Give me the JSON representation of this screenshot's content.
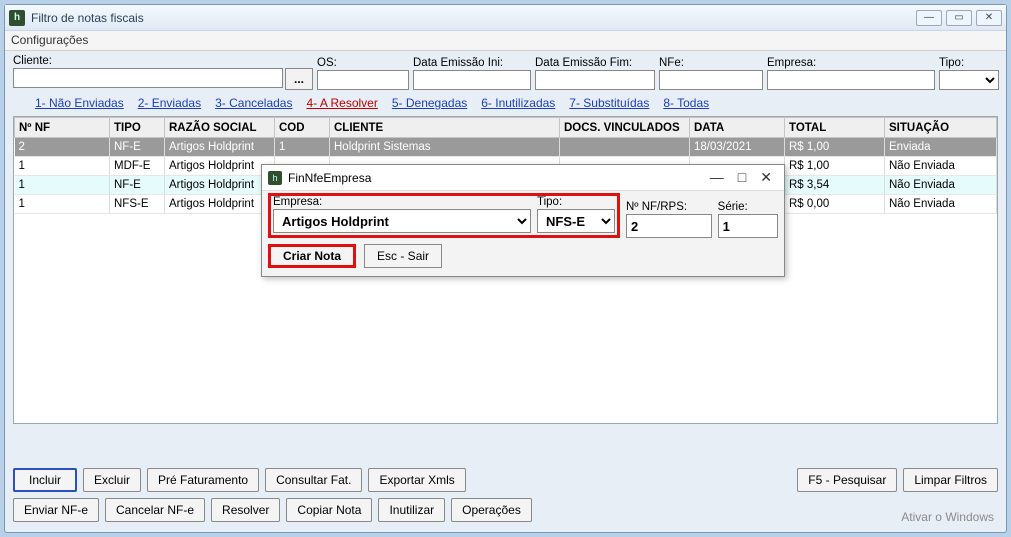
{
  "window": {
    "title": "Filtro de notas fiscais"
  },
  "menu": {
    "config": "Configurações"
  },
  "filters": {
    "cliente": {
      "label": "Cliente:",
      "value": ""
    },
    "os": {
      "label": "OS:",
      "value": ""
    },
    "data_ini": {
      "label": "Data Emissão Ini:",
      "value": ""
    },
    "data_fim": {
      "label": "Data Emissão Fim:",
      "value": ""
    },
    "nfe": {
      "label": "NFe:",
      "value": ""
    },
    "empresa": {
      "label": "Empresa:",
      "value": ""
    },
    "tipo": {
      "label": "Tipo:",
      "value": ""
    }
  },
  "tabs": {
    "t1": "1- Não Enviadas",
    "t2": "2- Enviadas",
    "t3": "3- Canceladas",
    "t4": "4- A Resolver",
    "t5": "5- Denegadas",
    "t6": "6- Inutilizadas",
    "t7": "7- Substituídas",
    "t8": "8- Todas"
  },
  "cols": {
    "nf": "Nº NF",
    "tipo": "TIPO",
    "razao": "RAZÃO SOCIAL",
    "cod": "COD",
    "cliente": "CLIENTE",
    "docs": "DOCS. VINCULADOS",
    "data": "DATA",
    "total": "TOTAL",
    "sit": "SITUAÇÃO"
  },
  "rows": [
    {
      "nf": "2",
      "tipo": "NF-E",
      "razao": "Artigos Holdprint",
      "cod": "1",
      "cliente": "Holdprint Sistemas",
      "docs": "",
      "data": "18/03/2021",
      "total": "R$ 1,00",
      "sit": "Enviada"
    },
    {
      "nf": "1",
      "tipo": "MDF-E",
      "razao": "Artigos Holdprint",
      "cod": "",
      "cliente": "",
      "docs": "",
      "data": "",
      "total": "R$ 1,00",
      "sit": "Não Enviada"
    },
    {
      "nf": "1",
      "tipo": "NF-E",
      "razao": "Artigos Holdprint",
      "cod": "",
      "cliente": "",
      "docs": "",
      "data": "",
      "total": "R$ 3,54",
      "sit": "Não Enviada"
    },
    {
      "nf": "1",
      "tipo": "NFS-E",
      "razao": "Artigos Holdprint",
      "cod": "",
      "cliente": "",
      "docs": "",
      "data": "",
      "total": "R$ 0,00",
      "sit": "Não Enviada"
    }
  ],
  "buttons": {
    "incluir": "Incluir",
    "excluir": "Excluir",
    "prefat": "Pré Faturamento",
    "consfat": "Consultar Fat.",
    "expxml": "Exportar Xmls",
    "pesquisar": "F5 - Pesquisar",
    "limpar": "Limpar Filtros",
    "enviar": "Enviar NF-e",
    "cancelar": "Cancelar NF-e",
    "resolver": "Resolver",
    "copiar": "Copiar Nota",
    "inutilizar": "Inutilizar",
    "operacoes": "Operações"
  },
  "watermark": {
    "l1": "Ativar o Windows",
    "l2": ""
  },
  "dialog": {
    "title": "FinNfeEmpresa",
    "empresa": {
      "label": "Empresa:",
      "value": "Artigos Holdprint"
    },
    "tipo": {
      "label": "Tipo:",
      "value": "NFS-E"
    },
    "nfnum": {
      "label": "Nº NF/RPS:",
      "value": "2"
    },
    "serie": {
      "label": "Série:",
      "value": "1"
    },
    "criar": "Criar Nota",
    "sair": "Esc - Sair"
  }
}
